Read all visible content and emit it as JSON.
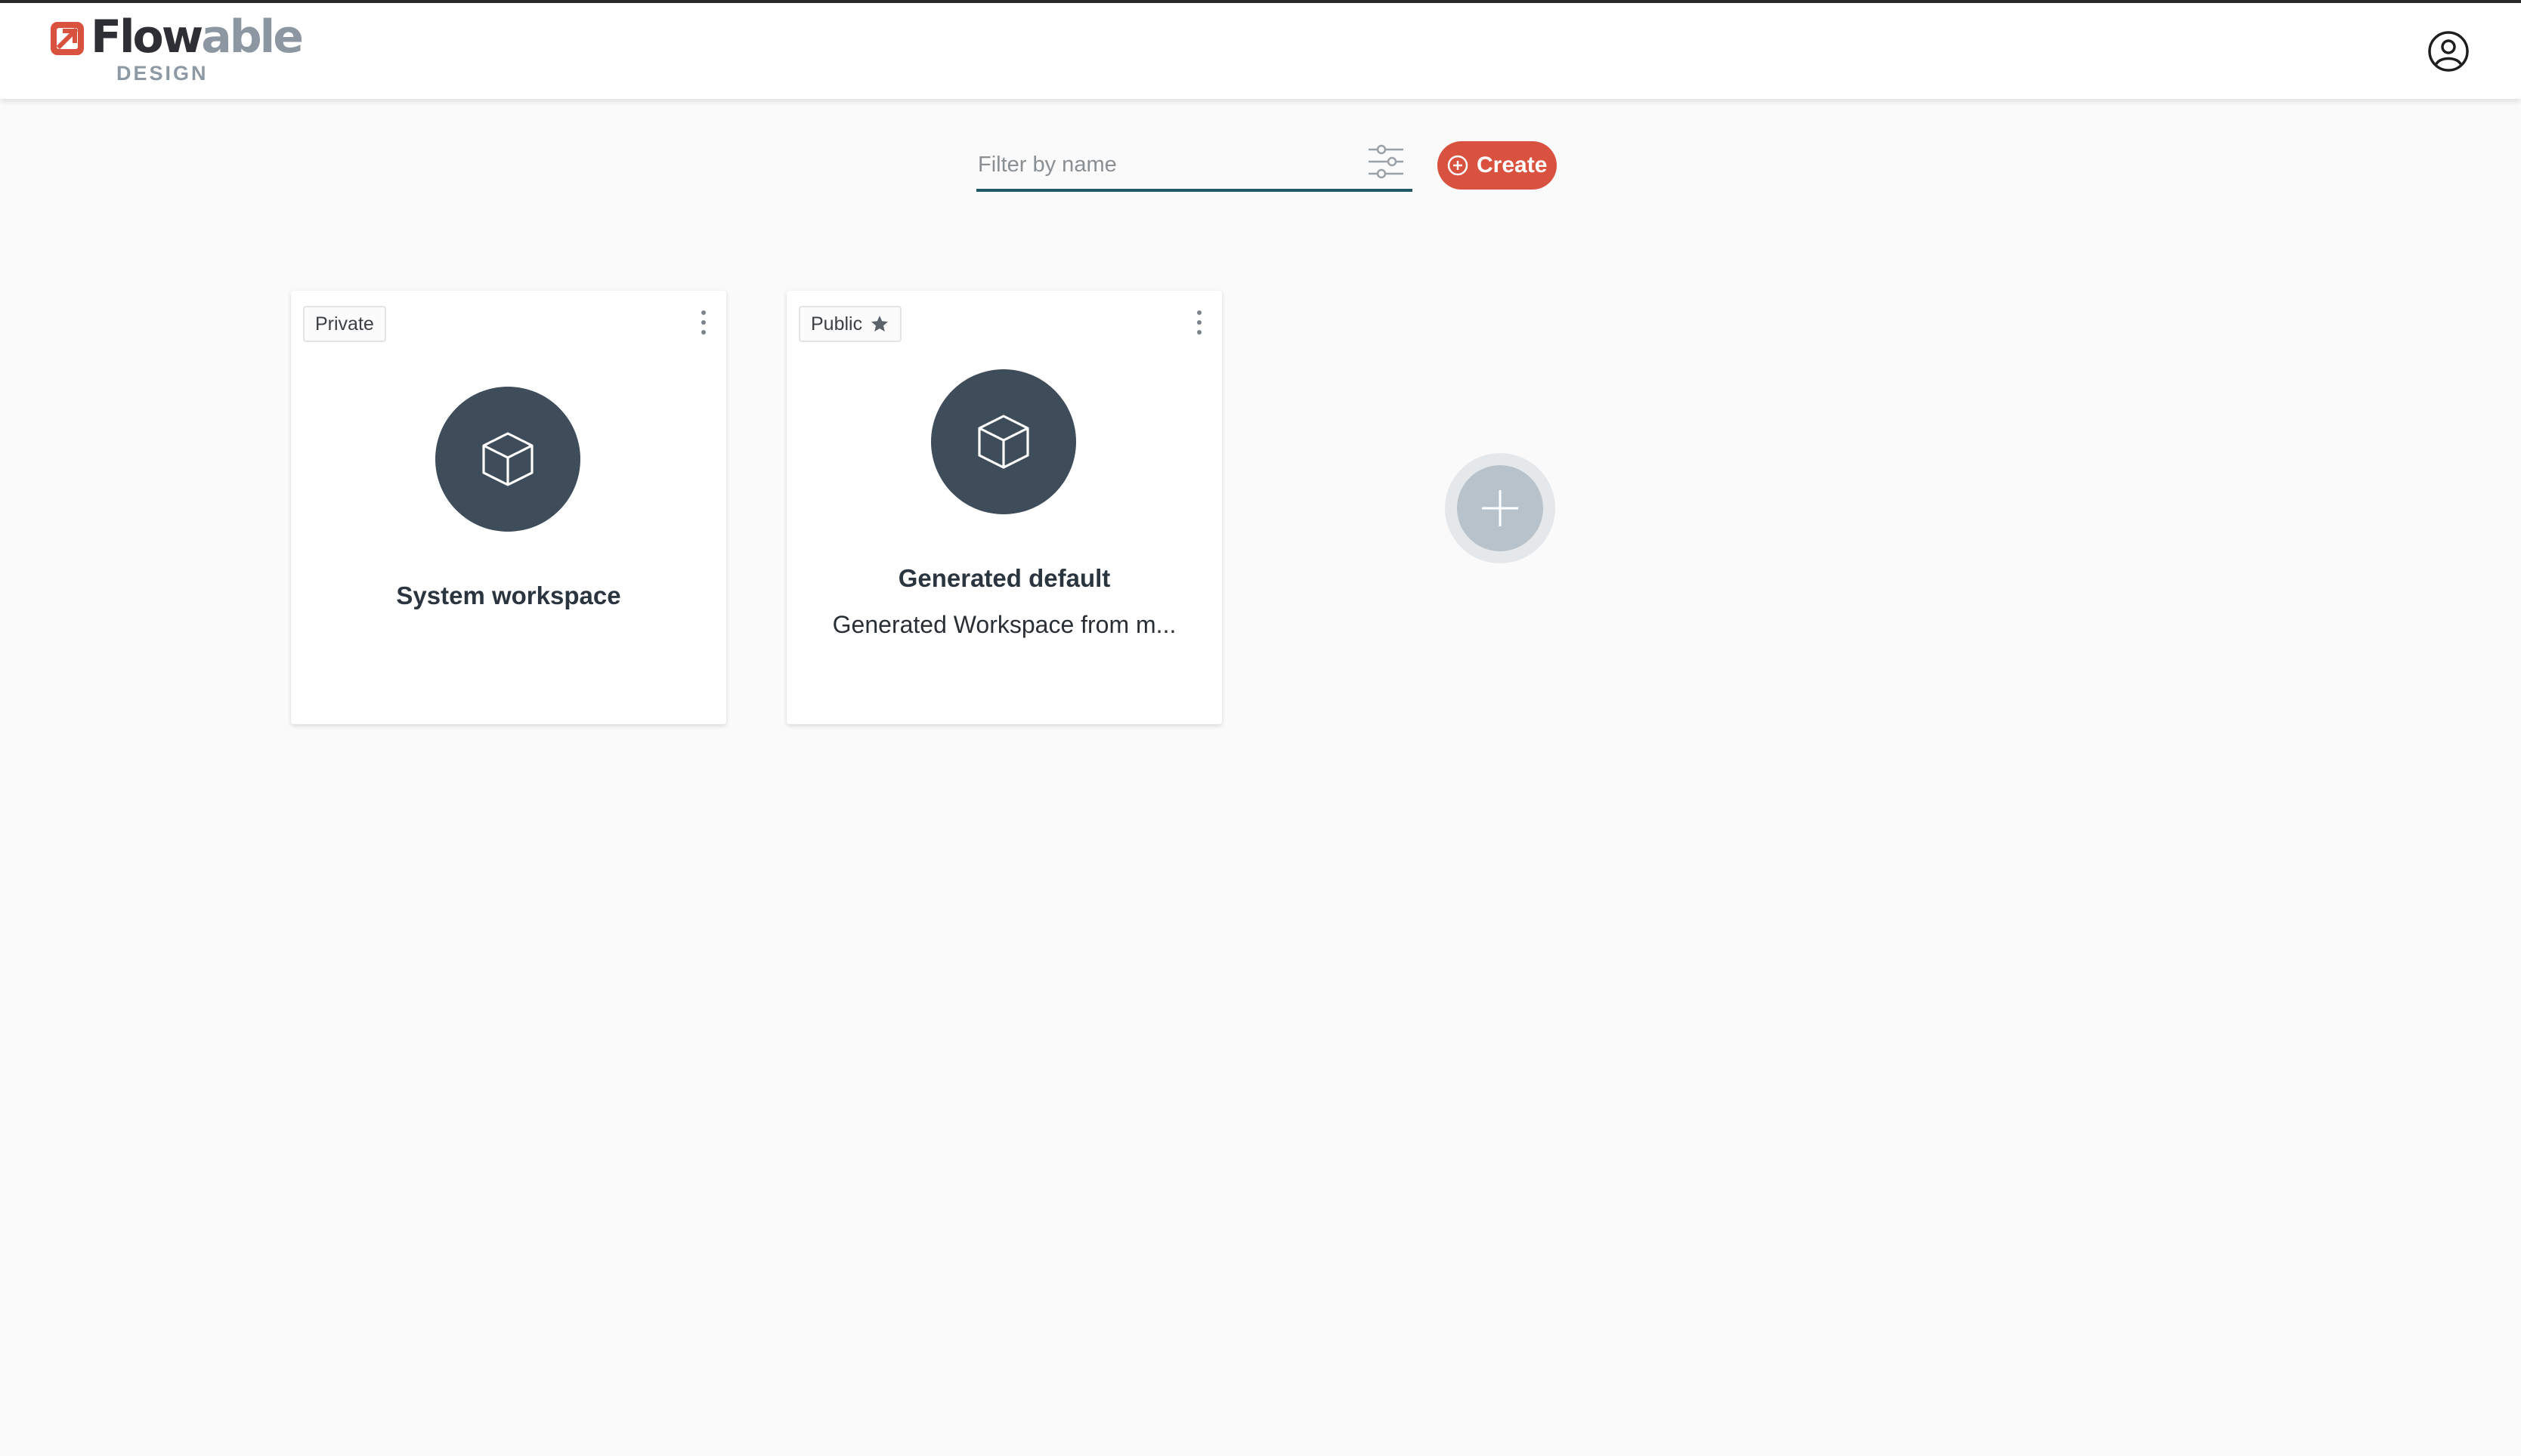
{
  "header": {
    "logo_dark": "Flow",
    "logo_light": "able",
    "logo_sub": "DESIGN",
    "user_icon": "user-circle-icon"
  },
  "toolbar": {
    "filter_placeholder": "Filter by name",
    "filter_icon": "sliders-icon",
    "create_label": "Create",
    "create_icon": "plus-circle-icon",
    "accent_color": "#d9513f"
  },
  "workspaces": [
    {
      "visibility": "Private",
      "title": "System workspace",
      "description": "",
      "icon": "cube-icon"
    },
    {
      "visibility": "Public",
      "title": "Generated default",
      "description": "Generated Workspace from m...",
      "icon": "cube-icon",
      "visibility_icon": "star-icon"
    }
  ],
  "add_workspace_icon": "plus-icon"
}
